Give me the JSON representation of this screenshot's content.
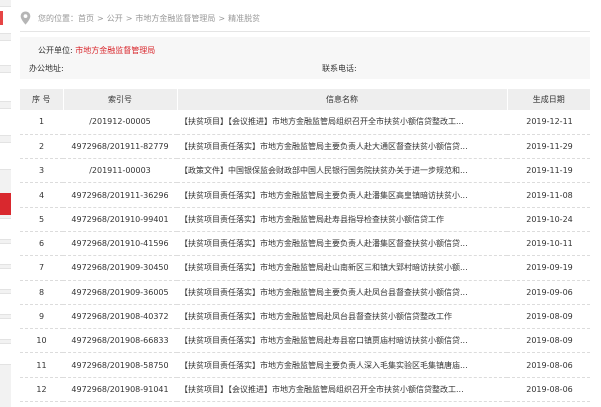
{
  "breadcrumb": {
    "icon": "location-pin-icon",
    "prefix": "您的位置：",
    "items": [
      "首页",
      "公开",
      "市地方金融监督管理局",
      "精准脱贫"
    ],
    "separator": ">"
  },
  "info": {
    "unit_label": "公开单位:",
    "unit_value": "市地方金融监督管理局",
    "address_label": "办公地址:",
    "address_value": "",
    "phone_label": "联系电话:",
    "phone_value": ""
  },
  "table": {
    "headers": [
      "序 号",
      "索引号",
      "信息名称",
      "生成日期"
    ],
    "rows": [
      {
        "no": "1",
        "index": "/201912-00005",
        "title": "【扶贫项目】【会议推进】市地方金融监管局组织召开全市扶贫小额信贷整改工...",
        "date": "2019-12-11"
      },
      {
        "no": "2",
        "index": "4972968/201911-82779",
        "title": "【扶贫项目责任落实】市地方金融监管局主要负责人赴大通区督查扶贫小额信贷...",
        "date": "2019-11-29"
      },
      {
        "no": "3",
        "index": "/201911-00003",
        "title": "【政策文件】中国银保监会财政部中国人民银行国务院扶贫办关于进一步规范和...",
        "date": "2019-11-19"
      },
      {
        "no": "4",
        "index": "4972968/201911-36296",
        "title": "【扶贫项目责任落实】市地方金融监管局主要负责人赴潘集区高皇镇暗访扶贫小...",
        "date": "2019-11-08"
      },
      {
        "no": "5",
        "index": "4972968/201910-99401",
        "title": "【扶贫项目责任落实】市地方金融监管局赴寿县指导检查扶贫小额信贷工作",
        "date": "2019-10-24"
      },
      {
        "no": "6",
        "index": "4972968/201910-41596",
        "title": "【扶贫项目责任落实】市地方金融监管局主要负责人赴潘集区督查扶贫小额信贷...",
        "date": "2019-10-11"
      },
      {
        "no": "7",
        "index": "4972968/201909-30450",
        "title": "【扶贫项目责任落实】市地方金融监管局赴山南新区三和镇大郢村暗访扶贫小额...",
        "date": "2019-09-19"
      },
      {
        "no": "8",
        "index": "4972968/201909-36005",
        "title": "【扶贫项目责任落实】市地方金融监管局主要负责人赴凤台县督查扶贫小额信贷...",
        "date": "2019-09-06"
      },
      {
        "no": "9",
        "index": "4972968/201908-40372",
        "title": "【扶贫项目责任落实】市地方金融监管局赴凤台县督查扶贫小额信贷整改工作",
        "date": "2019-08-09"
      },
      {
        "no": "10",
        "index": "4972968/201908-66833",
        "title": "【扶贫项目责任落实】市地方金融监管局赴寿县窑口镇贾庙村暗访扶贫小额信贷...",
        "date": "2019-08-09"
      },
      {
        "no": "11",
        "index": "4972968/201908-58750",
        "title": "【扶贫项目责任落实】市地方金融监管局主要负责人深入毛集实验区毛集镇唐庙...",
        "date": "2019-08-06"
      },
      {
        "no": "12",
        "index": "4972968/201908-91041",
        "title": "【扶贫项目】【会议推进】市地方金融监管局组织召开全市扶贫小额信贷整改工...",
        "date": "2019-08-06"
      }
    ]
  },
  "colors": {
    "accent": "#d9282e",
    "header_bg": "#eeeeee",
    "info_bg": "#f7f7f7"
  }
}
